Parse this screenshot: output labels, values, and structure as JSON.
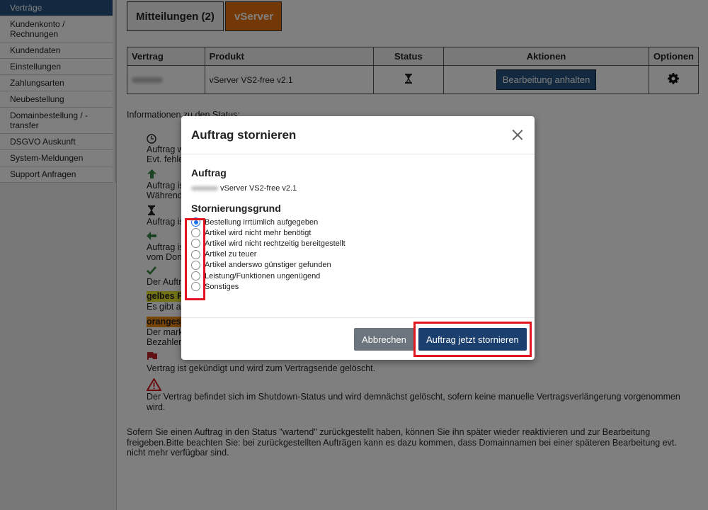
{
  "sidebar": {
    "items": [
      {
        "label": "Verträge",
        "active": true
      },
      {
        "label": "Kundenkonto / Rechnungen"
      },
      {
        "label": "Kundendaten"
      },
      {
        "label": "Einstellungen"
      },
      {
        "label": "Zahlungsarten"
      },
      {
        "label": "Neubestellung"
      },
      {
        "label": "Domainbestellung / -transfer"
      },
      {
        "label": "DSGVO Auskunft"
      },
      {
        "label": "System-Meldungen"
      },
      {
        "label": "Support Anfragen"
      }
    ]
  },
  "tabs": {
    "messages": "Mitteilungen (2)",
    "vserver": "vServer"
  },
  "table": {
    "headers": [
      "Vertrag",
      "Produkt",
      "Status",
      "Aktionen",
      "Optionen"
    ],
    "row": {
      "product": "vServer VS2-free v2.1",
      "status_icon": "hourglass-icon",
      "action_label": "Bearbeitung anhalten",
      "options_icon": "gear-icon"
    }
  },
  "info": {
    "heading": "Informationen zu den Status:",
    "lines": {
      "l1a": "Auftrag w",
      "l1b": "Evt. fehle",
      "l2a": "Auftrag is",
      "l2b": "Während",
      "l3a": "Auftrag is",
      "l4a": "Auftrag is",
      "l4b": "vom Don",
      "l5a": "Der Auftr",
      "yellow": "gelbes F",
      "yellow_desc": "Es gibt a",
      "orange": "oranges",
      "orange_desc1": "Der mark",
      "orange_desc2": "Bezahler",
      "flag_desc": "Vertrag ist gekündigt und wird zum Vertragsende gelöscht.",
      "warning_desc": "Der Vertrag befindet sich im Shutdown-Status und wird demnächst gelöscht, sofern keine manuelle Vertragsverlängerung vorgenommen wird."
    },
    "footnote": "Sofern Sie einen Auftrag in den Status \"wartend\" zurückgestellt haben, können Sie ihn später wieder reaktivieren und zur Bearbeitung freigeben.Bitte beachten Sie: bei zurückgestellten Aufträgen kann es dazu kommen, dass Domainnamen bei einer späteren Bearbeitung evt. nicht mehr verfügbar sind."
  },
  "modal": {
    "title": "Auftrag stornieren",
    "order_heading": "Auftrag",
    "order_text": "vServer VS2-free v2.1",
    "reason_heading": "Stornierungsgrund",
    "reasons": [
      {
        "label": "Bestellung irrtümlich aufgegeben",
        "checked": true
      },
      {
        "label": "Artikel wird nicht mehr benötigt"
      },
      {
        "label": "Artikel wird nicht rechtzeitig bereitgestellt"
      },
      {
        "label": "Artikel zu teuer"
      },
      {
        "label": "Artikel anderswo günstiger gefunden"
      },
      {
        "label": "Leistung/Funktionen ungenügend"
      },
      {
        "label": "Sonstiges"
      }
    ],
    "cancel_label": "Abbrechen",
    "submit_label": "Auftrag jetzt stornieren"
  },
  "colors": {
    "accent": "#25527e",
    "vserver_tab": "#e8700e",
    "highlight": "#e0151d"
  }
}
